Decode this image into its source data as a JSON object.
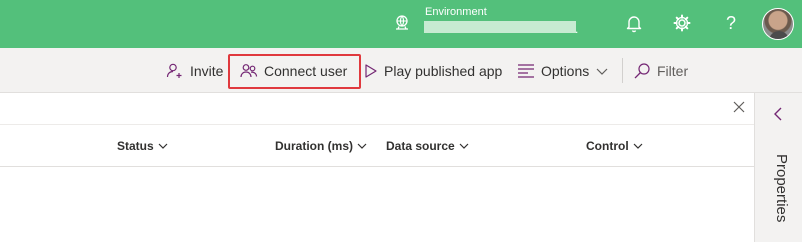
{
  "header": {
    "environment_title": "Environment",
    "environment_value_suffix": ".",
    "help_label": "?",
    "icons": [
      "environment-icon",
      "bell-icon",
      "gear-icon",
      "help-icon",
      "avatar"
    ],
    "background_color": "#53c07b"
  },
  "commandbar": {
    "invite_label": "Invite",
    "connect_user_label": "Connect user",
    "play_published_app_label": "Play published app",
    "options_label": "Options",
    "filter_label": "Filter",
    "highlight_color": "#e0393e"
  },
  "columns": [
    {
      "label": "Status"
    },
    {
      "label": "Duration (ms)"
    },
    {
      "label": "Data source"
    },
    {
      "label": "Control"
    }
  ],
  "rail": {
    "properties_label": "Properties"
  },
  "accent_color": "#742774"
}
